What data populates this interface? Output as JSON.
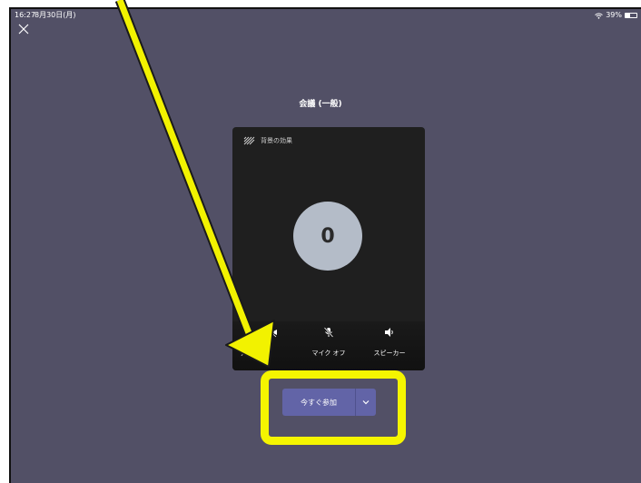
{
  "status_bar": {
    "time": "16:27",
    "date": "8月30日(月)",
    "battery": "39%"
  },
  "close_icon": "close-icon",
  "meeting": {
    "title": "会議 (一般)"
  },
  "preview": {
    "background_effects_label": "背景の効果",
    "avatar_initial": "0",
    "controls": {
      "video_label": "デオ オフ",
      "mic_label": "マイク オフ",
      "speaker_label": "スピーカー"
    }
  },
  "join": {
    "button_label": "今すぐ参加"
  },
  "colors": {
    "background": "#525066",
    "card": "#1f1f1f",
    "accent": "#6264a7",
    "highlight": "#f5f500"
  }
}
